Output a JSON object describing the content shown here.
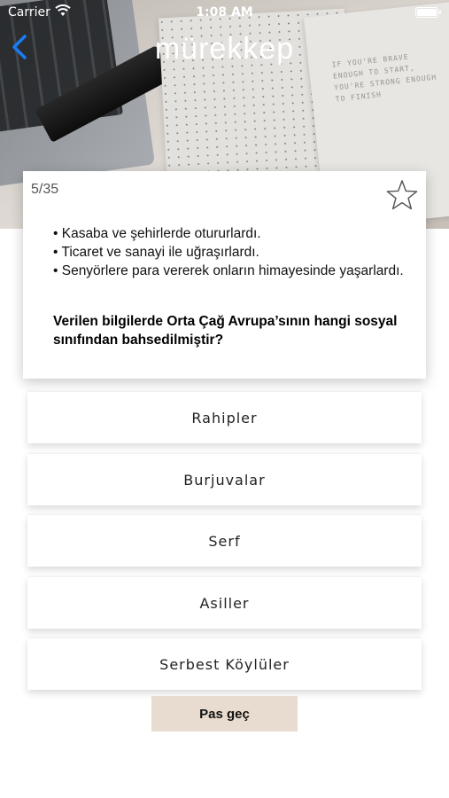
{
  "status_bar": {
    "carrier": "Carrier",
    "time": "1:08 AM"
  },
  "nav": {
    "title": "mürekkep",
    "back_icon": "chevron-left-icon"
  },
  "hero": {
    "notebook_quote": "IF YOU'RE BRAVE ENOUGH TO START, YOU'RE STRONG ENOUGH TO FINISH"
  },
  "question": {
    "counter": "5/35",
    "favorite_icon": "star-outline-icon",
    "bullets": [
      "• Kasaba ve şehirlerde otururlardı.",
      "• Ticaret ve sanayi ile uğraşırlardı.",
      "• Senyörlere para vererek onların himayesinde yaşarlardı."
    ],
    "prompt": "Verilen bilgilerde Orta Çağ Avrupa’sının hangi sosyal sınıfından bahsedilmiştir?"
  },
  "options": [
    "Rahipler",
    "Burjuvalar",
    "Serf",
    "Asiller",
    "Serbest Köylüler"
  ],
  "actions": {
    "skip_label": "Pas geç"
  },
  "colors": {
    "accent": "#1a7cf5",
    "skip_button_bg": "#e7dccf",
    "card_bg": "#ffffff"
  }
}
